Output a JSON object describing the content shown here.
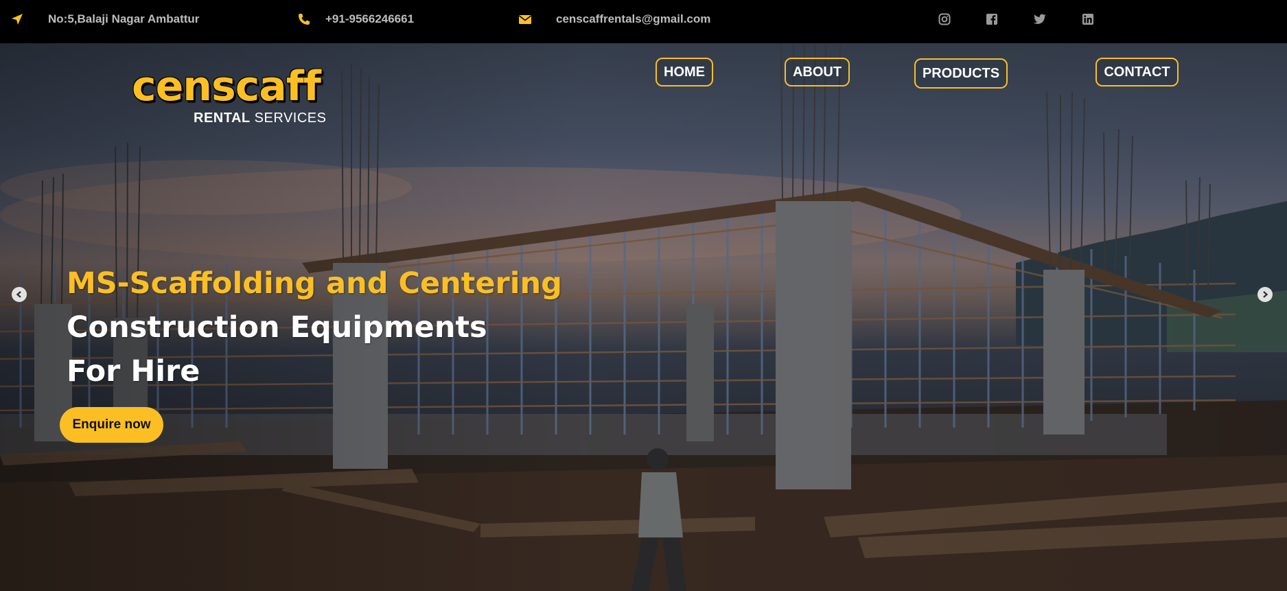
{
  "topbar": {
    "address": "No:5,Balaji Nagar Ambattur",
    "phone": "+91-9566246661",
    "email": "censcaffrentals@gmail.com",
    "icon_color": "#fbbf24",
    "icons": [
      "location-arrow-icon",
      "phone-icon",
      "envelope-icon"
    ],
    "social": [
      "instagram-icon",
      "facebook-icon",
      "twitter-icon",
      "linkedin-icon"
    ]
  },
  "logo": {
    "brand": "censcaff",
    "sub_bold": "RENTAL",
    "sub_light": " SERVICES"
  },
  "nav": {
    "items": [
      {
        "label": "HOME"
      },
      {
        "label": "ABOUT"
      },
      {
        "label": "PRODUCTS"
      },
      {
        "label": "CONTACT"
      }
    ]
  },
  "hero": {
    "line1": "MS-Scaffolding and Centering",
    "line2": "Construction Equipments",
    "line3": "For Hire",
    "cta": "Enquire now",
    "accent_color": "#fbbf24",
    "prev_icon": "chevron-left-icon",
    "next_icon": "chevron-right-icon"
  }
}
